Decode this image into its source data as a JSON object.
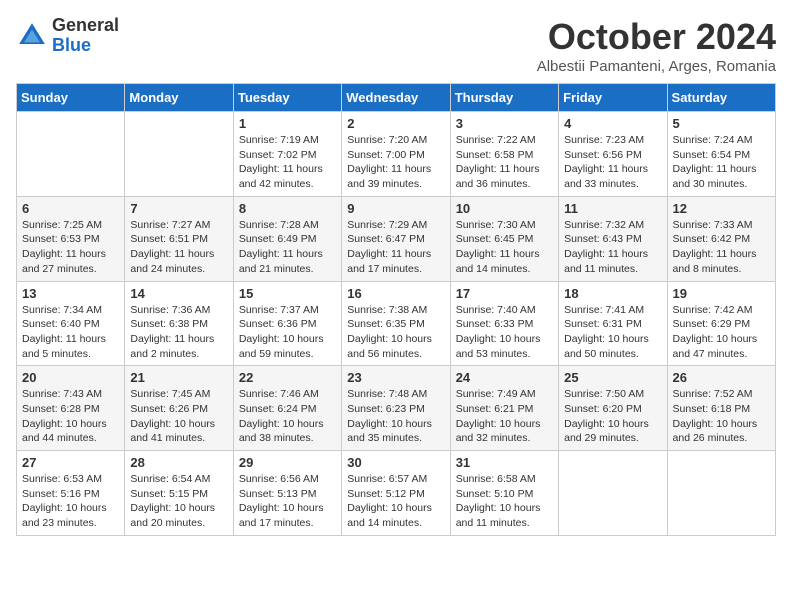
{
  "header": {
    "logo_general": "General",
    "logo_blue": "Blue",
    "month_title": "October 2024",
    "location": "Albestii Pamanteni, Arges, Romania"
  },
  "weekdays": [
    "Sunday",
    "Monday",
    "Tuesday",
    "Wednesday",
    "Thursday",
    "Friday",
    "Saturday"
  ],
  "weeks": [
    [
      {
        "day": "",
        "info": ""
      },
      {
        "day": "",
        "info": ""
      },
      {
        "day": "1",
        "info": "Sunrise: 7:19 AM\nSunset: 7:02 PM\nDaylight: 11 hours and 42 minutes."
      },
      {
        "day": "2",
        "info": "Sunrise: 7:20 AM\nSunset: 7:00 PM\nDaylight: 11 hours and 39 minutes."
      },
      {
        "day": "3",
        "info": "Sunrise: 7:22 AM\nSunset: 6:58 PM\nDaylight: 11 hours and 36 minutes."
      },
      {
        "day": "4",
        "info": "Sunrise: 7:23 AM\nSunset: 6:56 PM\nDaylight: 11 hours and 33 minutes."
      },
      {
        "day": "5",
        "info": "Sunrise: 7:24 AM\nSunset: 6:54 PM\nDaylight: 11 hours and 30 minutes."
      }
    ],
    [
      {
        "day": "6",
        "info": "Sunrise: 7:25 AM\nSunset: 6:53 PM\nDaylight: 11 hours and 27 minutes."
      },
      {
        "day": "7",
        "info": "Sunrise: 7:27 AM\nSunset: 6:51 PM\nDaylight: 11 hours and 24 minutes."
      },
      {
        "day": "8",
        "info": "Sunrise: 7:28 AM\nSunset: 6:49 PM\nDaylight: 11 hours and 21 minutes."
      },
      {
        "day": "9",
        "info": "Sunrise: 7:29 AM\nSunset: 6:47 PM\nDaylight: 11 hours and 17 minutes."
      },
      {
        "day": "10",
        "info": "Sunrise: 7:30 AM\nSunset: 6:45 PM\nDaylight: 11 hours and 14 minutes."
      },
      {
        "day": "11",
        "info": "Sunrise: 7:32 AM\nSunset: 6:43 PM\nDaylight: 11 hours and 11 minutes."
      },
      {
        "day": "12",
        "info": "Sunrise: 7:33 AM\nSunset: 6:42 PM\nDaylight: 11 hours and 8 minutes."
      }
    ],
    [
      {
        "day": "13",
        "info": "Sunrise: 7:34 AM\nSunset: 6:40 PM\nDaylight: 11 hours and 5 minutes."
      },
      {
        "day": "14",
        "info": "Sunrise: 7:36 AM\nSunset: 6:38 PM\nDaylight: 11 hours and 2 minutes."
      },
      {
        "day": "15",
        "info": "Sunrise: 7:37 AM\nSunset: 6:36 PM\nDaylight: 10 hours and 59 minutes."
      },
      {
        "day": "16",
        "info": "Sunrise: 7:38 AM\nSunset: 6:35 PM\nDaylight: 10 hours and 56 minutes."
      },
      {
        "day": "17",
        "info": "Sunrise: 7:40 AM\nSunset: 6:33 PM\nDaylight: 10 hours and 53 minutes."
      },
      {
        "day": "18",
        "info": "Sunrise: 7:41 AM\nSunset: 6:31 PM\nDaylight: 10 hours and 50 minutes."
      },
      {
        "day": "19",
        "info": "Sunrise: 7:42 AM\nSunset: 6:29 PM\nDaylight: 10 hours and 47 minutes."
      }
    ],
    [
      {
        "day": "20",
        "info": "Sunrise: 7:43 AM\nSunset: 6:28 PM\nDaylight: 10 hours and 44 minutes."
      },
      {
        "day": "21",
        "info": "Sunrise: 7:45 AM\nSunset: 6:26 PM\nDaylight: 10 hours and 41 minutes."
      },
      {
        "day": "22",
        "info": "Sunrise: 7:46 AM\nSunset: 6:24 PM\nDaylight: 10 hours and 38 minutes."
      },
      {
        "day": "23",
        "info": "Sunrise: 7:48 AM\nSunset: 6:23 PM\nDaylight: 10 hours and 35 minutes."
      },
      {
        "day": "24",
        "info": "Sunrise: 7:49 AM\nSunset: 6:21 PM\nDaylight: 10 hours and 32 minutes."
      },
      {
        "day": "25",
        "info": "Sunrise: 7:50 AM\nSunset: 6:20 PM\nDaylight: 10 hours and 29 minutes."
      },
      {
        "day": "26",
        "info": "Sunrise: 7:52 AM\nSunset: 6:18 PM\nDaylight: 10 hours and 26 minutes."
      }
    ],
    [
      {
        "day": "27",
        "info": "Sunrise: 6:53 AM\nSunset: 5:16 PM\nDaylight: 10 hours and 23 minutes."
      },
      {
        "day": "28",
        "info": "Sunrise: 6:54 AM\nSunset: 5:15 PM\nDaylight: 10 hours and 20 minutes."
      },
      {
        "day": "29",
        "info": "Sunrise: 6:56 AM\nSunset: 5:13 PM\nDaylight: 10 hours and 17 minutes."
      },
      {
        "day": "30",
        "info": "Sunrise: 6:57 AM\nSunset: 5:12 PM\nDaylight: 10 hours and 14 minutes."
      },
      {
        "day": "31",
        "info": "Sunrise: 6:58 AM\nSunset: 5:10 PM\nDaylight: 10 hours and 11 minutes."
      },
      {
        "day": "",
        "info": ""
      },
      {
        "day": "",
        "info": ""
      }
    ]
  ]
}
